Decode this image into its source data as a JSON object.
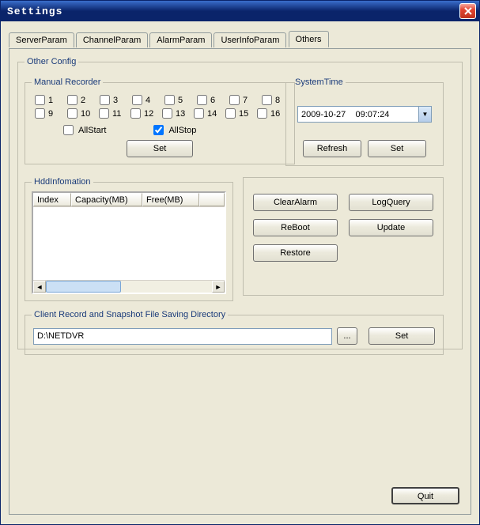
{
  "window": {
    "title": "Settings"
  },
  "tabs": {
    "items": [
      {
        "label": "ServerParam"
      },
      {
        "label": "ChannelParam"
      },
      {
        "label": "AlarmParam"
      },
      {
        "label": "UserInfoParam"
      },
      {
        "label": "Others"
      }
    ],
    "active_index": 4
  },
  "other_config": {
    "legend": "Other Config",
    "manual_recorder": {
      "legend": "Manual Recorder",
      "channels_row1": [
        "1",
        "2",
        "3",
        "4",
        "5",
        "6",
        "7",
        "8"
      ],
      "channels_row2": [
        "9",
        "10",
        "11",
        "12",
        "13",
        "14",
        "15",
        "16"
      ],
      "allstart_label": "AllStart",
      "allstart_checked": false,
      "allstop_label": "AllStop",
      "allstop_checked": true,
      "set_label": "Set"
    },
    "system_time": {
      "legend": "SystemTime",
      "value": "2009-10-27    09:07:24",
      "refresh_label": "Refresh",
      "set_label": "Set"
    },
    "hdd": {
      "legend": "HddInfomation",
      "columns": {
        "index": "Index",
        "capacity": "Capacity(MB)",
        "free": "Free(MB)"
      }
    },
    "actions": {
      "clear_alarm": "ClearAlarm",
      "log_query": "LogQuery",
      "reboot": "ReBoot",
      "update": "Update",
      "restore": "Restore"
    },
    "save_dir": {
      "legend": "Client Record and Snapshot File Saving Directory",
      "path": "D:\\NETDVR",
      "browse_label": "...",
      "set_label": "Set"
    }
  },
  "footer": {
    "quit_label": "Quit"
  }
}
